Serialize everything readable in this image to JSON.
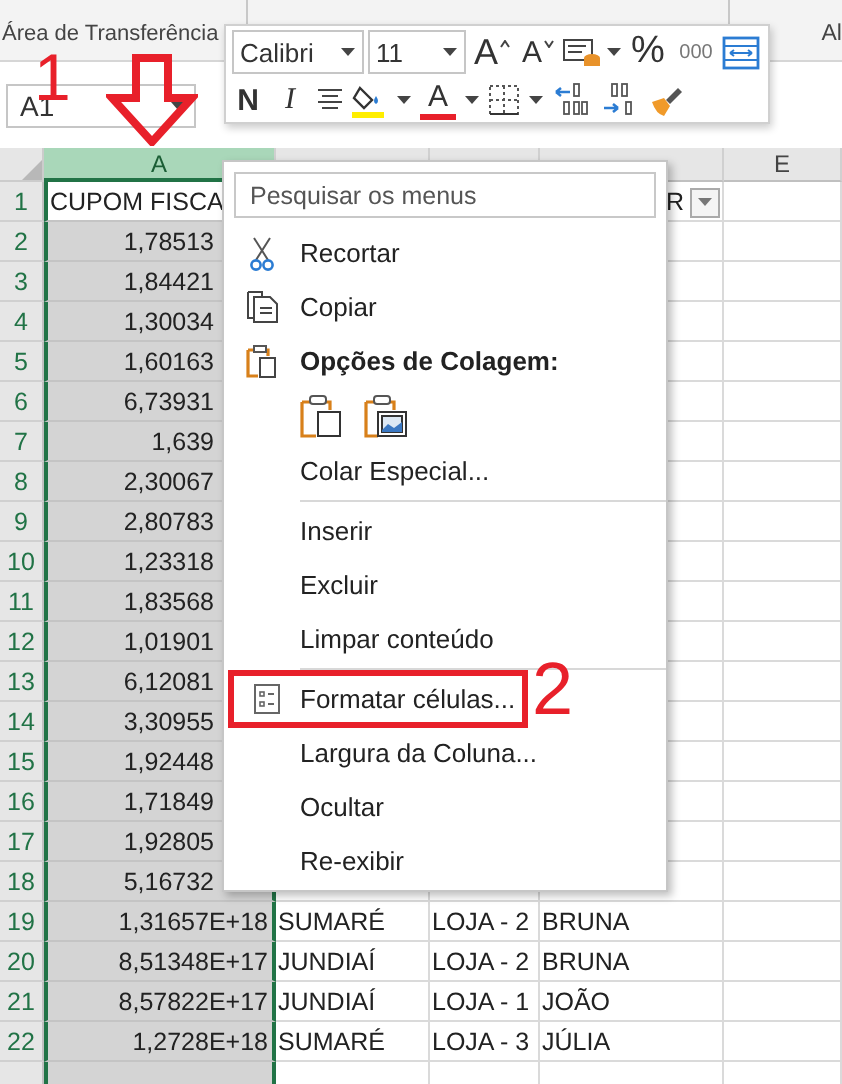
{
  "ribbon": {
    "group_label": "Área de Transferência",
    "next_group_label": "Al"
  },
  "mini_toolbar": {
    "font": "Calibri",
    "size": "11",
    "grow_font": "A",
    "shrink_font": "A",
    "percent": "%",
    "thousands": "000",
    "bold": "N",
    "italic": "I",
    "font_color": "A"
  },
  "name_box": {
    "value": "A1"
  },
  "columns": [
    {
      "label": "A",
      "selected": true
    },
    {
      "selected": false
    },
    {
      "selected": false
    },
    {
      "selected": false
    },
    {
      "label": "E",
      "selected": false
    }
  ],
  "rows": [
    {
      "number": "1",
      "active": true,
      "covered": false,
      "filter_button": true,
      "cells": [
        "CUPOM FISCA",
        null,
        null,
        "R",
        null
      ]
    },
    {
      "number": "2",
      "active": false,
      "covered": true,
      "cells": [
        "1,78513"
      ]
    },
    {
      "number": "3",
      "active": false,
      "covered": true,
      "cells": [
        "1,84421"
      ]
    },
    {
      "number": "4",
      "active": false,
      "covered": true,
      "cells": [
        "1,30034"
      ]
    },
    {
      "number": "5",
      "active": false,
      "covered": true,
      "cells": [
        "1,60163"
      ]
    },
    {
      "number": "6",
      "active": false,
      "covered": true,
      "cells": [
        "6,73931"
      ]
    },
    {
      "number": "7",
      "active": false,
      "covered": true,
      "cells": [
        "1,639"
      ]
    },
    {
      "number": "8",
      "active": false,
      "covered": true,
      "cells": [
        "2,30067"
      ]
    },
    {
      "number": "9",
      "active": false,
      "covered": true,
      "cells": [
        "2,80783"
      ]
    },
    {
      "number": "10",
      "active": false,
      "covered": true,
      "cells": [
        "1,23318"
      ]
    },
    {
      "number": "11",
      "active": false,
      "covered": true,
      "cells": [
        "1,83568"
      ]
    },
    {
      "number": "12",
      "active": false,
      "covered": true,
      "cells": [
        "1,01901"
      ]
    },
    {
      "number": "13",
      "active": false,
      "covered": true,
      "cells": [
        "6,12081"
      ]
    },
    {
      "number": "14",
      "active": false,
      "covered": true,
      "cells": [
        "3,30955"
      ]
    },
    {
      "number": "15",
      "active": false,
      "covered": true,
      "cells": [
        "1,92448"
      ]
    },
    {
      "number": "16",
      "active": false,
      "covered": true,
      "cells": [
        "1,71849"
      ]
    },
    {
      "number": "17",
      "active": false,
      "covered": true,
      "cells": [
        "1,92805"
      ]
    },
    {
      "number": "18",
      "active": false,
      "covered": true,
      "cells": [
        "5,16732"
      ]
    },
    {
      "number": "19",
      "active": false,
      "covered": false,
      "cells": [
        "1,31657E+18",
        "SUMARÉ",
        "LOJA - 2",
        "BRUNA",
        null
      ]
    },
    {
      "number": "20",
      "active": false,
      "covered": false,
      "cells": [
        "8,51348E+17",
        "JUNDIAÍ",
        "LOJA - 2",
        "BRUNA",
        null
      ]
    },
    {
      "number": "21",
      "active": false,
      "covered": false,
      "cells": [
        "8,57822E+17",
        "JUNDIAÍ",
        "LOJA - 1",
        "JOÃO",
        null
      ]
    },
    {
      "number": "22",
      "active": false,
      "covered": false,
      "cells": [
        "1,2728E+18",
        "SUMARÉ",
        "LOJA - 3",
        "JÚLIA",
        null
      ]
    }
  ],
  "context_menu": {
    "search": {
      "placeholder": "Pesquisar os menus"
    },
    "items": [
      {
        "kind": "command",
        "label": "Recortar"
      },
      {
        "kind": "command",
        "label": "Copiar"
      },
      {
        "kind": "header",
        "label": "Opções de Colagem:"
      },
      {
        "kind": "paste_options"
      },
      {
        "kind": "command",
        "label": "Colar Especial..."
      },
      {
        "kind": "separator"
      },
      {
        "kind": "command",
        "label": "Inserir"
      },
      {
        "kind": "command",
        "label": "Excluir"
      },
      {
        "kind": "command",
        "label": "Limpar conteúdo"
      },
      {
        "kind": "separator"
      },
      {
        "kind": "command",
        "label": "Formatar células...",
        "marked": true,
        "callout": "2"
      },
      {
        "kind": "command",
        "label": "Largura da Coluna..."
      },
      {
        "kind": "command",
        "label": "Ocultar"
      },
      {
        "kind": "command",
        "label": "Re-exibir"
      }
    ]
  },
  "annotations": [
    {
      "kind": "step",
      "label": "1"
    },
    {
      "kind": "arrow"
    }
  ]
}
